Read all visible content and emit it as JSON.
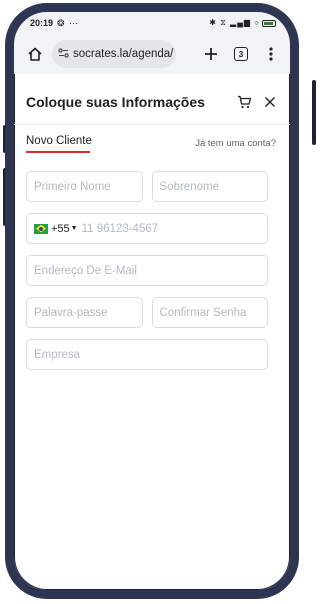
{
  "status_bar": {
    "time": "20:19",
    "left_icons": "❂ ⋯",
    "right_icons": "✱ ⧖ ▂▄▆ ⌔"
  },
  "browser": {
    "url_host": "socrates.la",
    "url_path": "/agenda/",
    "tab_count": "3",
    "home_icon": "home-icon",
    "site_info_icon": "site-settings-icon",
    "new_tab_icon": "plus-icon",
    "menu_icon": "more-vert-icon"
  },
  "header": {
    "title": "Coloque suas Informações",
    "cart_icon": "cart-icon",
    "close_icon": "close-icon"
  },
  "tabs": {
    "new_client": "Novo Cliente",
    "have_account": "Já tem uma conta?"
  },
  "form": {
    "first_name_placeholder": "Primeiro Nome",
    "last_name_placeholder": "Sobrenome",
    "country_code": "+55",
    "phone_placeholder": "11 96123-4567",
    "email_placeholder": "Endereço De E-Mail",
    "password_placeholder": "Palavra-passe",
    "confirm_password_placeholder": "Confirmar Senha",
    "company_placeholder": "Empresa"
  },
  "colors": {
    "frame": "#2e3552",
    "tab_underline": "#d93025",
    "toolbar_bg": "#f1f3f4"
  }
}
